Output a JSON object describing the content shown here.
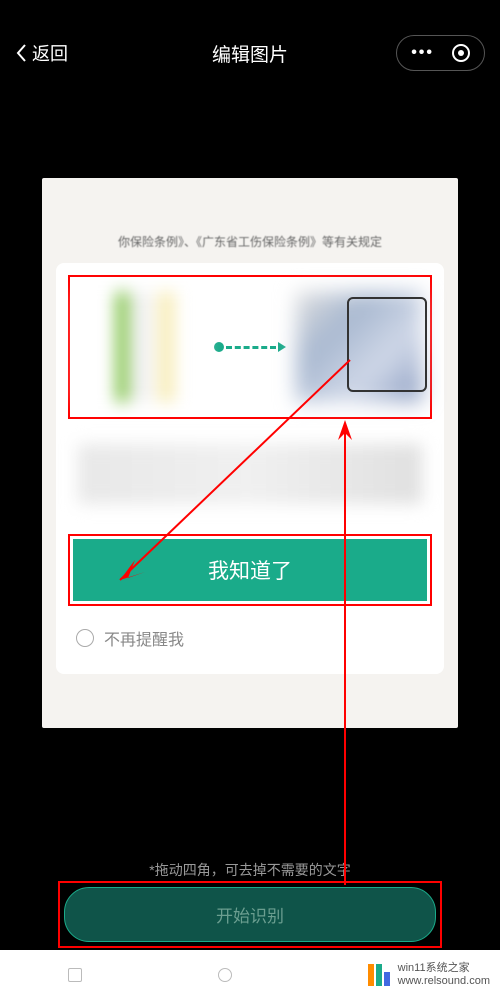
{
  "header": {
    "back_label": "返回",
    "title": "编辑图片"
  },
  "photo_text": "你保险条例》、《广东省工伤保险条例》等有关规定",
  "modal": {
    "confirm_label": "我知道了",
    "checkbox_label": "不再提醒我"
  },
  "hint": "*拖动四角，可去掉不需要的文字",
  "bottom_button": "开始识别",
  "watermark": {
    "line1": "win11系统之家",
    "line2": "www.relsound.com"
  },
  "icons": {
    "back": "chevron-left",
    "more": "dots",
    "target": "circle-dot"
  },
  "colors": {
    "accent": "#1aab8a",
    "highlight": "#ff0000"
  }
}
